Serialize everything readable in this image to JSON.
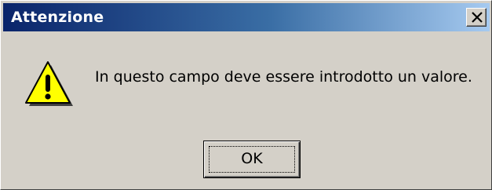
{
  "dialog": {
    "title": "Attenzione",
    "close_icon": "close-icon",
    "message": "In questo campo deve essere introdotto un valore.",
    "icon": "warning-icon",
    "ok_label": "OK"
  },
  "colors": {
    "titlebar_start": "#0a246a",
    "titlebar_end": "#a6caf0",
    "face": "#d4d0c8",
    "warning_fill": "#ffff00"
  }
}
